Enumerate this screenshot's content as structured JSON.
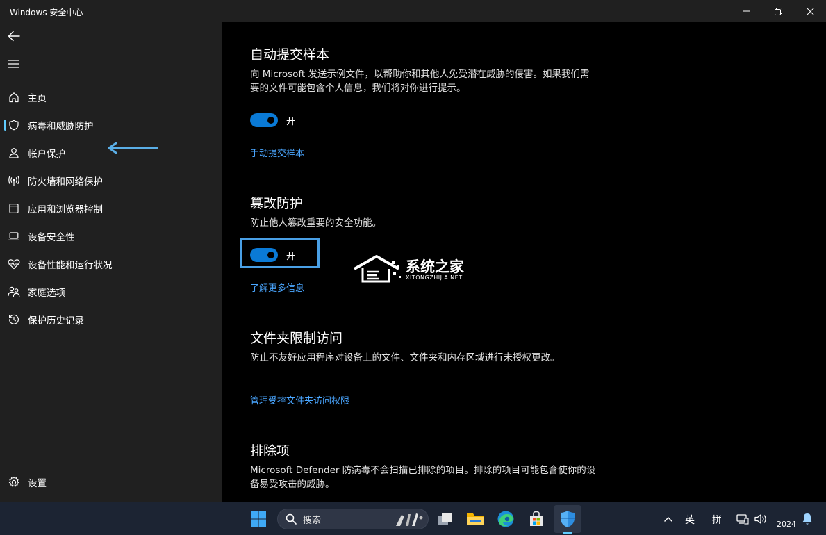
{
  "window": {
    "title": "Windows 安全中心"
  },
  "sidebar": {
    "items": [
      {
        "label": "主页",
        "icon": "home-icon"
      },
      {
        "label": "病毒和威胁防护",
        "icon": "shield-icon",
        "active": true
      },
      {
        "label": "帐户保护",
        "icon": "person-icon"
      },
      {
        "label": "防火墙和网络保护",
        "icon": "wireless-icon"
      },
      {
        "label": "应用和浏览器控制",
        "icon": "app-window-icon"
      },
      {
        "label": "设备安全性",
        "icon": "laptop-icon"
      },
      {
        "label": "设备性能和运行状况",
        "icon": "heart-pulse-icon"
      },
      {
        "label": "家庭选项",
        "icon": "family-icon"
      },
      {
        "label": "保护历史记录",
        "icon": "history-icon"
      }
    ],
    "settings_label": "设置"
  },
  "main": {
    "sections": [
      {
        "title": "自动提交样本",
        "desc": "向 Microsoft 发送示例文件，以帮助你和其他人免受潜在威胁的侵害。如果我们需要的文件可能包含个人信息，我们将对你进行提示。",
        "toggle_label": "开",
        "link": "手动提交样本"
      },
      {
        "title": "篡改防护",
        "desc": "防止他人篡改重要的安全功能。",
        "toggle_label": "开",
        "link": "了解更多信息"
      },
      {
        "title": "文件夹限制访问",
        "desc": "防止不友好应用程序对设备上的文件、文件夹和内存区域进行未授权更改。",
        "link": "管理受控文件夹访问权限"
      },
      {
        "title": "排除项",
        "desc": "Microsoft Defender 防病毒不会扫描已排除的项目。排除的项目可能包含使你的设备易受攻击的威胁。"
      }
    ]
  },
  "watermark": {
    "text": "系统之家",
    "sub": "XITONGZHIJIA.NET"
  },
  "taskbar": {
    "search_placeholder": "搜索",
    "ime_lang": "英",
    "ime_mode": "拼",
    "clock": "2024"
  },
  "colors": {
    "accent": "#60cdff",
    "toggle_on": "#0a7ad6",
    "link": "#4aa6ff",
    "highlight_box": "#4aa0e6",
    "annotation_arrow": "#5aaee6"
  }
}
